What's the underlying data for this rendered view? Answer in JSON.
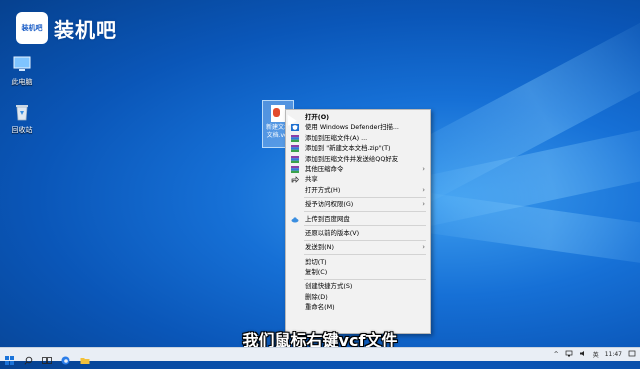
{
  "watermark": {
    "badge_text": "装机吧",
    "brand_text": "装机吧"
  },
  "desktop": {
    "icons": [
      {
        "label": "此电脑",
        "icon": "computer-icon"
      },
      {
        "label": "回收站",
        "icon": "recycle-bin-icon"
      }
    ],
    "selected_file": {
      "label": "新建文本\n文档.vcf",
      "icon": "vcf-contact-file-icon"
    }
  },
  "context_menu": {
    "items": [
      {
        "type": "item",
        "label": "打开(O)",
        "bold": true
      },
      {
        "type": "item",
        "label": "使用 Windows Defender扫描...",
        "icon": "defender-shield-icon"
      },
      {
        "type": "item",
        "label": "添加到压缩文件(A) ...",
        "icon": "winrar-archive-icon"
      },
      {
        "type": "item",
        "label": "添加到 \"新建文本文档.zip\"(T)",
        "icon": "winrar-archive-icon"
      },
      {
        "type": "item",
        "label": "添加到压缩文件并发送给QQ好友",
        "icon": "winrar-archive-icon"
      },
      {
        "type": "item",
        "label": "其他压缩命令",
        "icon": "winrar-archive-icon",
        "submenu": true
      },
      {
        "type": "item",
        "label": "共享",
        "icon": "share-icon"
      },
      {
        "type": "item",
        "label": "打开方式(H)",
        "submenu": true
      },
      {
        "type": "separator"
      },
      {
        "type": "item",
        "label": "授予访问权限(G)",
        "submenu": true
      },
      {
        "type": "separator"
      },
      {
        "type": "item",
        "label": "上传到百度网盘",
        "icon": "baidu-cloud-icon"
      },
      {
        "type": "separator"
      },
      {
        "type": "item",
        "label": "还原以前的版本(V)"
      },
      {
        "type": "separator"
      },
      {
        "type": "item",
        "label": "发送到(N)",
        "submenu": true
      },
      {
        "type": "separator"
      },
      {
        "type": "item",
        "label": "剪切(T)"
      },
      {
        "type": "item",
        "label": "复制(C)"
      },
      {
        "type": "separator"
      },
      {
        "type": "item",
        "label": "创建快捷方式(S)"
      },
      {
        "type": "item",
        "label": "删除(D)"
      },
      {
        "type": "item",
        "label": "重命名(M)"
      }
    ]
  },
  "subtitle": "我们鼠标右键vcf文件",
  "taskbar": {
    "buttons": [
      "windows-start-icon",
      "search-icon",
      "task-view-icon",
      "edge-browser-icon",
      "file-explorer-icon"
    ],
    "tray": {
      "ime": "英",
      "time": "11:47"
    }
  },
  "colors": {
    "menu_bg": "#f2f2f2",
    "desktop_blue": "#0a56b8",
    "taskbar_bg": "#e9eef5"
  }
}
